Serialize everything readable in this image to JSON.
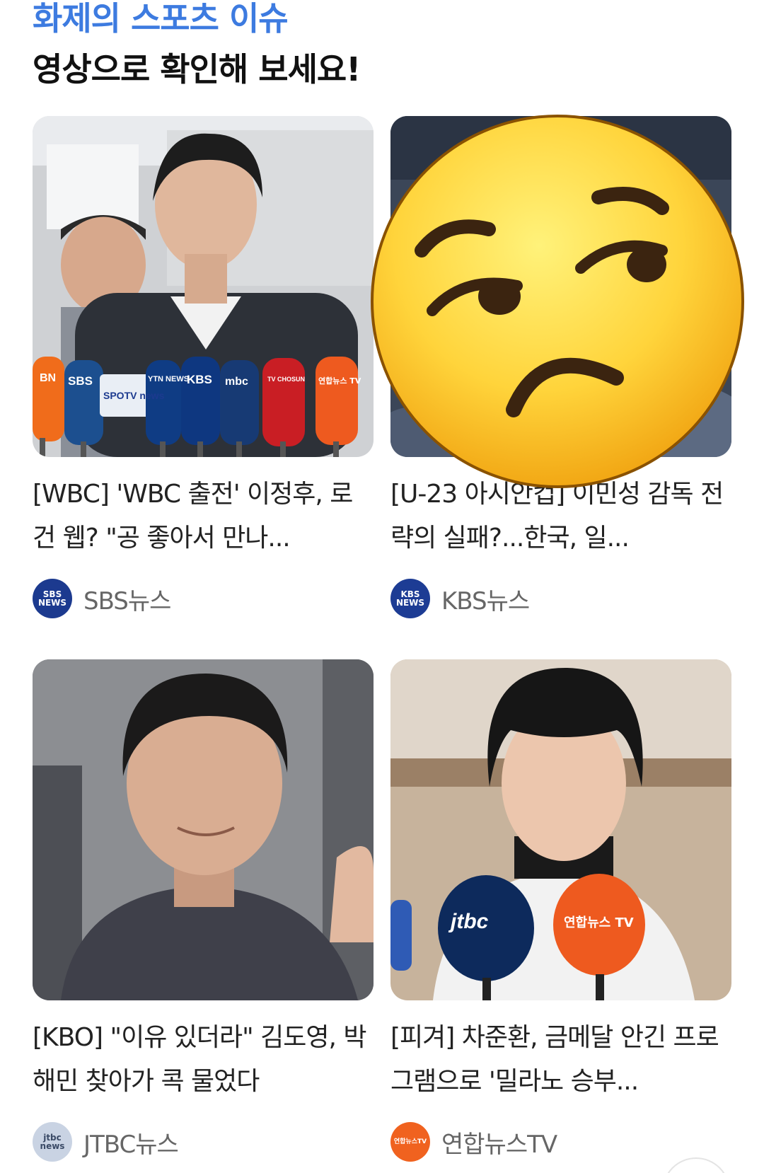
{
  "section": {
    "eyebrow": "화제의 스포츠 이슈",
    "headline": "영상으로 확인해 보세요!"
  },
  "cards": [
    {
      "title": "[WBC] 'WBC 출전' 이정후, 로건 웹? \"공 좋아서 만나...",
      "source": "SBS뉴스",
      "logo_text": "SBS\nNEWS",
      "logo_color": "#1c3a8f",
      "mic_labels": [
        "BN",
        "SBS",
        "SPOTV news",
        "YTN NEWS",
        "KBS",
        "mbc",
        "TV CHOSUN",
        "연합뉴스 TV"
      ]
    },
    {
      "title": "[U-23 아시안컵] 이민성 감독 전략의 실패?...한국, 일...",
      "source": "KBS뉴스",
      "logo_text": "KBS\nNEWS",
      "logo_color": "#1d3c94"
    },
    {
      "title": "[KBO] \"이유 있더라\" 김도영, 박해민 찾아가 콕 물었다",
      "source": "JTBC뉴스",
      "logo_text": "jtbc\nnews",
      "logo_color": "#c9d3e3"
    },
    {
      "title": "[피겨] 차준환, 금메달 안긴 프로그램으로 '밀라노 승부...",
      "source": "연합뉴스TV",
      "logo_text": "연합뉴스TV",
      "logo_color": "#f0621f",
      "mic_labels": [
        "jtbc",
        "연합뉴스 TV"
      ]
    }
  ],
  "overlay": {
    "emoji": "unamused-face-emoji"
  },
  "colors": {
    "eyebrow": "#3d7be0",
    "title": "#222222",
    "source": "#666666"
  }
}
